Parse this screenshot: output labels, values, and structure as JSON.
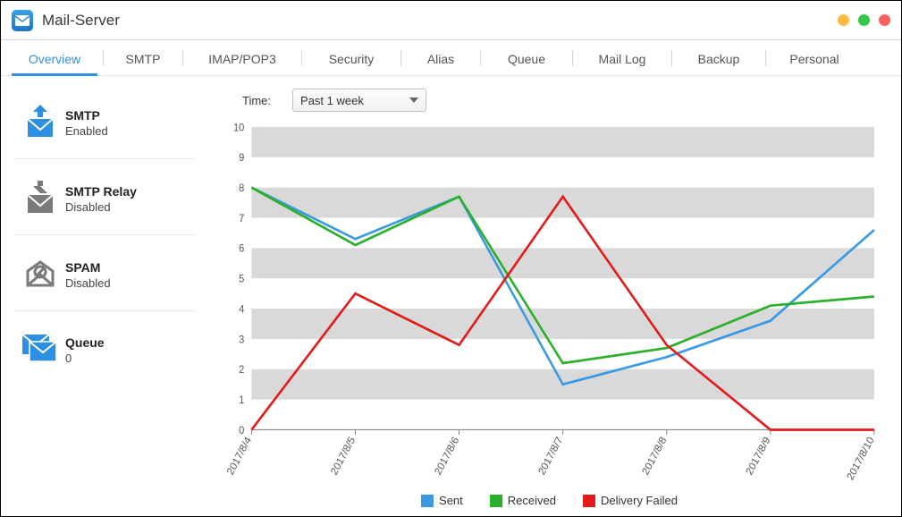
{
  "header": {
    "title": "Mail-Server"
  },
  "tabs": [
    "Overview",
    "SMTP",
    "IMAP/POP3",
    "Security",
    "Alias",
    "Queue",
    "Mail Log",
    "Backup",
    "Personal"
  ],
  "active_tab": 0,
  "sidebar": {
    "items": [
      {
        "title": "SMTP",
        "status": "Enabled"
      },
      {
        "title": "SMTP Relay",
        "status": "Disabled"
      },
      {
        "title": "SPAM",
        "status": "Disabled"
      },
      {
        "title": "Queue",
        "status": "0"
      }
    ]
  },
  "time": {
    "label": "Time:",
    "selected": "Past 1 week"
  },
  "legend": {
    "sent": "Sent",
    "received": "Received",
    "failed": "Delivery Failed"
  },
  "colors": {
    "sent": "#3b9ae2",
    "received": "#2bb02b",
    "failed": "#e11b1b"
  },
  "chart_data": {
    "type": "line",
    "categories": [
      "2017/8/4",
      "2017/8/5",
      "2017/8/6",
      "2017/8/7",
      "2017/8/8",
      "2017/8/9",
      "2017/8/10"
    ],
    "series": [
      {
        "name": "Sent",
        "values": [
          8.0,
          6.3,
          7.7,
          1.5,
          2.4,
          3.6,
          6.6
        ]
      },
      {
        "name": "Received",
        "values": [
          8.0,
          6.1,
          7.7,
          2.2,
          2.7,
          4.1,
          4.4
        ]
      },
      {
        "name": "Delivery Failed",
        "values": [
          0.0,
          4.5,
          2.8,
          7.7,
          2.8,
          0.0,
          0.0
        ]
      }
    ],
    "ylim": [
      0,
      10
    ],
    "yticks": [
      0,
      1,
      2,
      3,
      4,
      5,
      6,
      7,
      8,
      9,
      10
    ],
    "xlabel": "",
    "ylabel": "",
    "title": ""
  }
}
